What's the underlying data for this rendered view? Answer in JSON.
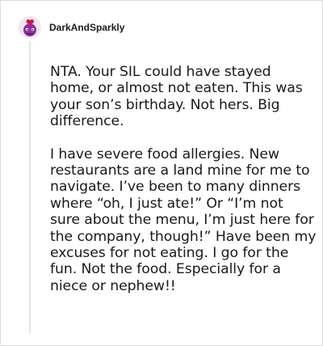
{
  "comment": {
    "author": "DarkAndSparkly",
    "avatar_icon": "avatar-icon",
    "paragraphs": [
      "NTA. Your SIL could have stayed home, or almost not eaten. This was your son’s birthday. Not hers. Big difference.",
      "I have severe food allergies. New restaurants are a land mine for me to navigate. I’ve been to many dinners where “oh, I just ate!” Or “I’m not sure about the menu, I’m just here for the company, though!” Have been my excuses for not eating. I go for the fun. Not the food. Especially for a niece or nephew!!"
    ]
  }
}
